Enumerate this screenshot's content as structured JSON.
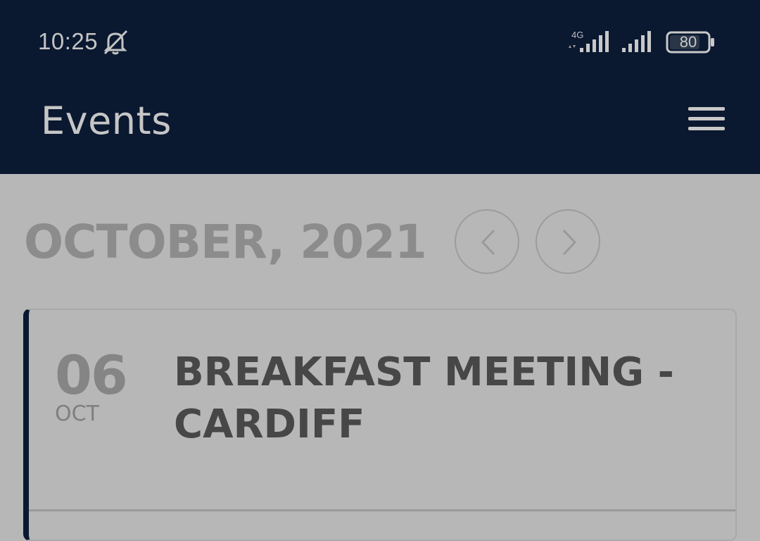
{
  "status_bar": {
    "time": "10:25",
    "network": "4G",
    "battery": "80",
    "icons": [
      "bell-off-icon",
      "signal-icon",
      "signal-icon",
      "battery-icon"
    ]
  },
  "app_bar": {
    "title": "Events",
    "menu_icon": "hamburger-menu-icon"
  },
  "calendar": {
    "month_label": "OCTOBER, 2021",
    "prev_icon": "chevron-left-icon",
    "next_icon": "chevron-right-icon"
  },
  "events": [
    {
      "day": "06",
      "month": "OCT",
      "title": "BREAKFAST MEETING - CARDIFF"
    }
  ],
  "colors": {
    "header_bg": "#0a1830",
    "page_bg": "#b7b7b7",
    "accent": "#0a1830"
  }
}
